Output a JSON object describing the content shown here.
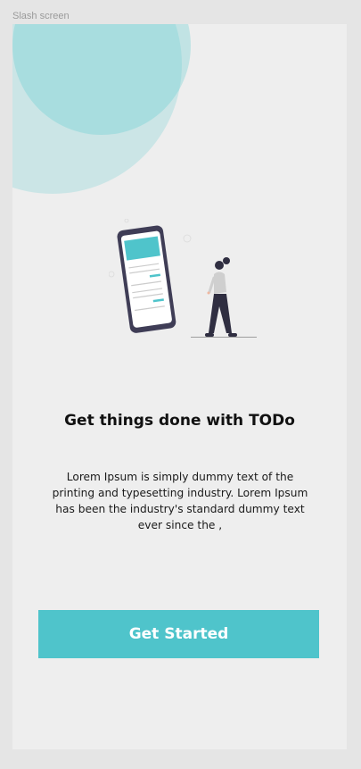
{
  "frame": {
    "label": "Slash screen"
  },
  "onboarding": {
    "title": "Get things done with TODo",
    "description": "Lorem Ipsum is simply dummy text of the printing and typesetting industry. Lorem Ipsum has been the industry's standard dummy text ever since the ,",
    "cta_label": "Get Started"
  },
  "illustration": {
    "icon": "person-with-phone-illustration"
  },
  "colors": {
    "accent": "#4fc4cb",
    "background": "#eeeeee",
    "canvas": "#e5e5e5",
    "decor_circle": "#bfe9e9",
    "phone_frame": "#3f3d56"
  }
}
